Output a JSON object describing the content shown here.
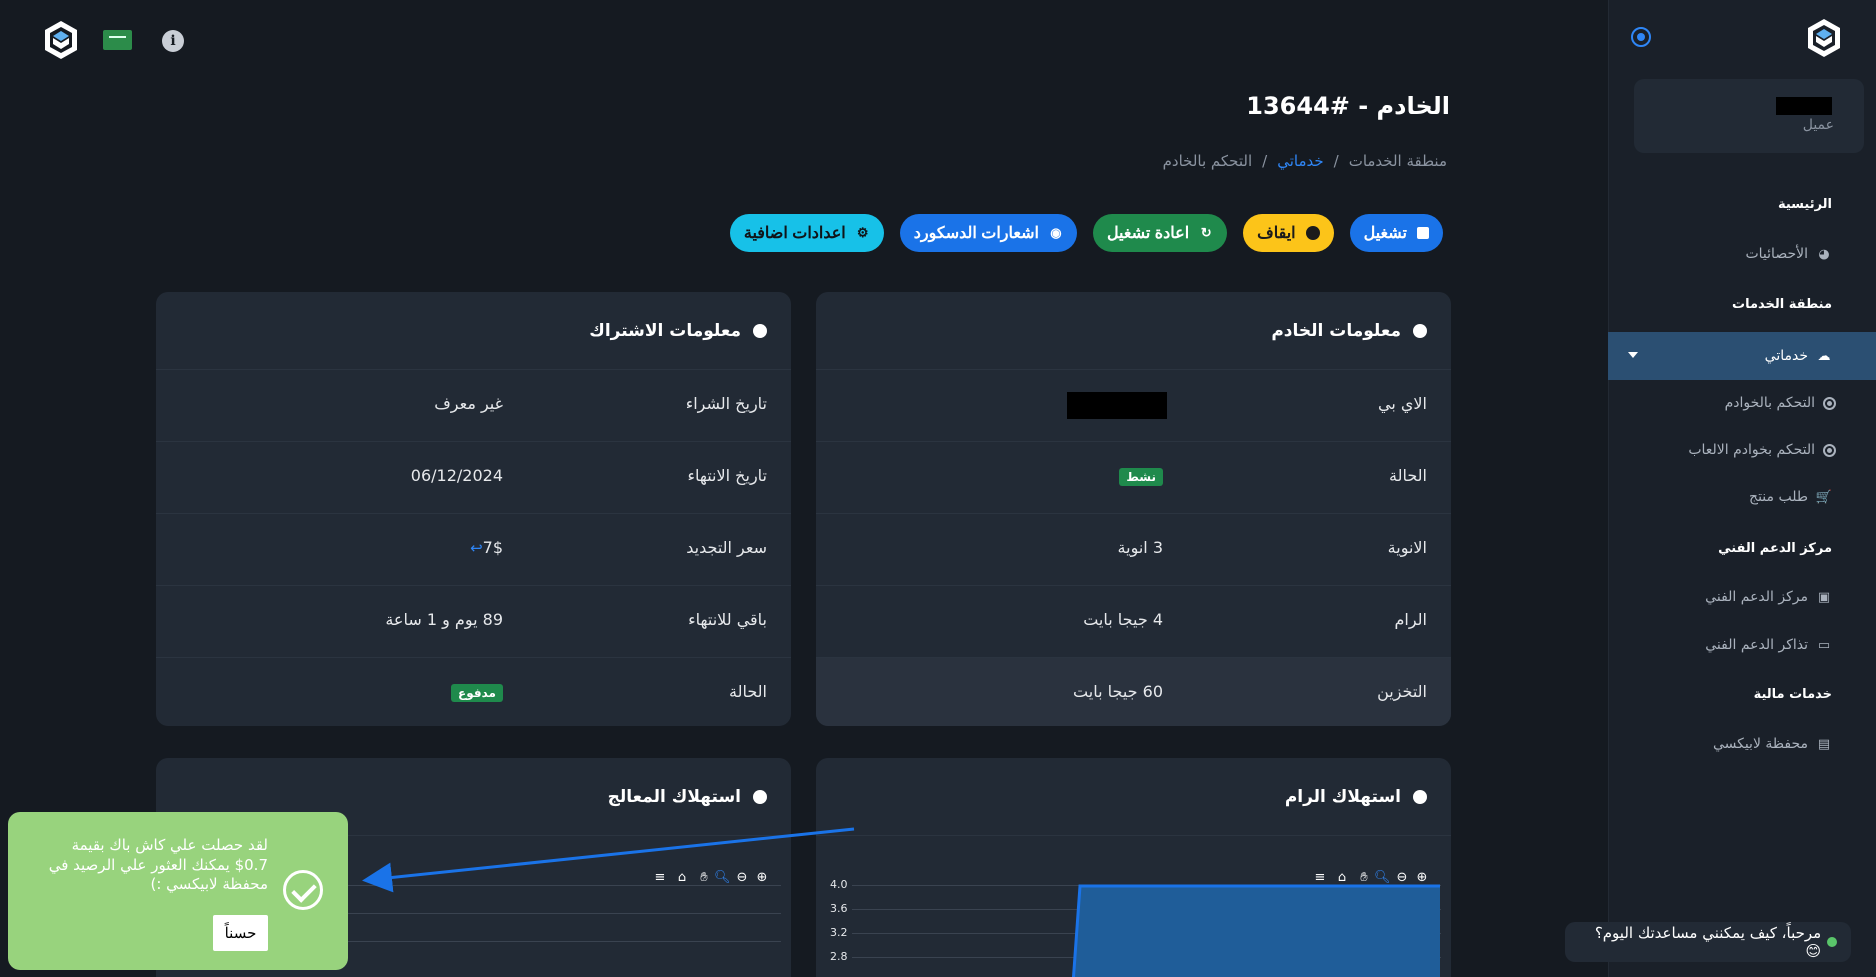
{
  "header": {
    "title": "الخادم - #13644",
    "breadcrumb": [
      "منطقة الخدمات",
      "/",
      "خدماتي",
      "/",
      "التحكم بالخادم"
    ]
  },
  "actions": {
    "start": "تشغيل",
    "stop": "ايقاف",
    "restart": "اعادة تشغيل",
    "discord": "اشعارات الدسكورد",
    "extra": "اعدادات اضافية"
  },
  "sidebar": {
    "user_role": "عميل",
    "items": [
      {
        "label": "الرئيسية"
      },
      {
        "label": "الأحصائيات"
      },
      {
        "label": "منطقة الخدمات"
      },
      {
        "label": "خدماتي"
      },
      {
        "label": "التحكم بالخوادم"
      },
      {
        "label": "التحكم بخوادم الالعاب"
      },
      {
        "label": "طلب منتج"
      },
      {
        "label": "مركز الدعم الفني"
      },
      {
        "label": "مركز الدعم الفني"
      },
      {
        "label": "تذاكر الدعم الفني"
      },
      {
        "label": "خدمات مالية"
      },
      {
        "label": "محفظة لابيكسي"
      }
    ]
  },
  "server_info": {
    "title": "معلومات الخادم",
    "rows": [
      {
        "label": "الاي بي",
        "value": ""
      },
      {
        "label": "الحالة",
        "value": "نشط"
      },
      {
        "label": "الانوية",
        "value": "3 انوية"
      },
      {
        "label": "الرام",
        "value": "4 جيجا بايت"
      },
      {
        "label": "التخزين",
        "value": "60 جيجا بايت"
      }
    ]
  },
  "subscription_info": {
    "title": "معلومات الاشتراك",
    "rows": [
      {
        "label": "تاريخ الشراء",
        "value": "غير معرف"
      },
      {
        "label": "تاريخ الانتهاء",
        "value": "06/12/2024"
      },
      {
        "label": "سعر التجديد",
        "value": "7$"
      },
      {
        "label": "باقي للانتهاء",
        "value": "89 يوم و 1 ساعة"
      },
      {
        "label": "الحالة",
        "value": "مدفوع"
      }
    ]
  },
  "ram_chart": {
    "title": "استهلاك الرام",
    "yticks": [
      "4.0",
      "3.6",
      "3.2",
      "2.8"
    ]
  },
  "cpu_chart": {
    "title": "استهلاك المعالج"
  },
  "toast": {
    "message": "لقد حصلت علي كاش باك بقيمة 0.7$ يمكنك العثور علي الرصيد في محفظة لابيكسي :)",
    "ok_label": "حسناً"
  },
  "chat": {
    "text": "مرحباً، كيف يمكنني مساعدتك اليوم؟ 😊"
  },
  "colors": {
    "accent": "#1a73e8",
    "success": "#1f8a4c",
    "warning": "#fcc419",
    "info": "#17c1e8",
    "toast": "#98d37d"
  }
}
